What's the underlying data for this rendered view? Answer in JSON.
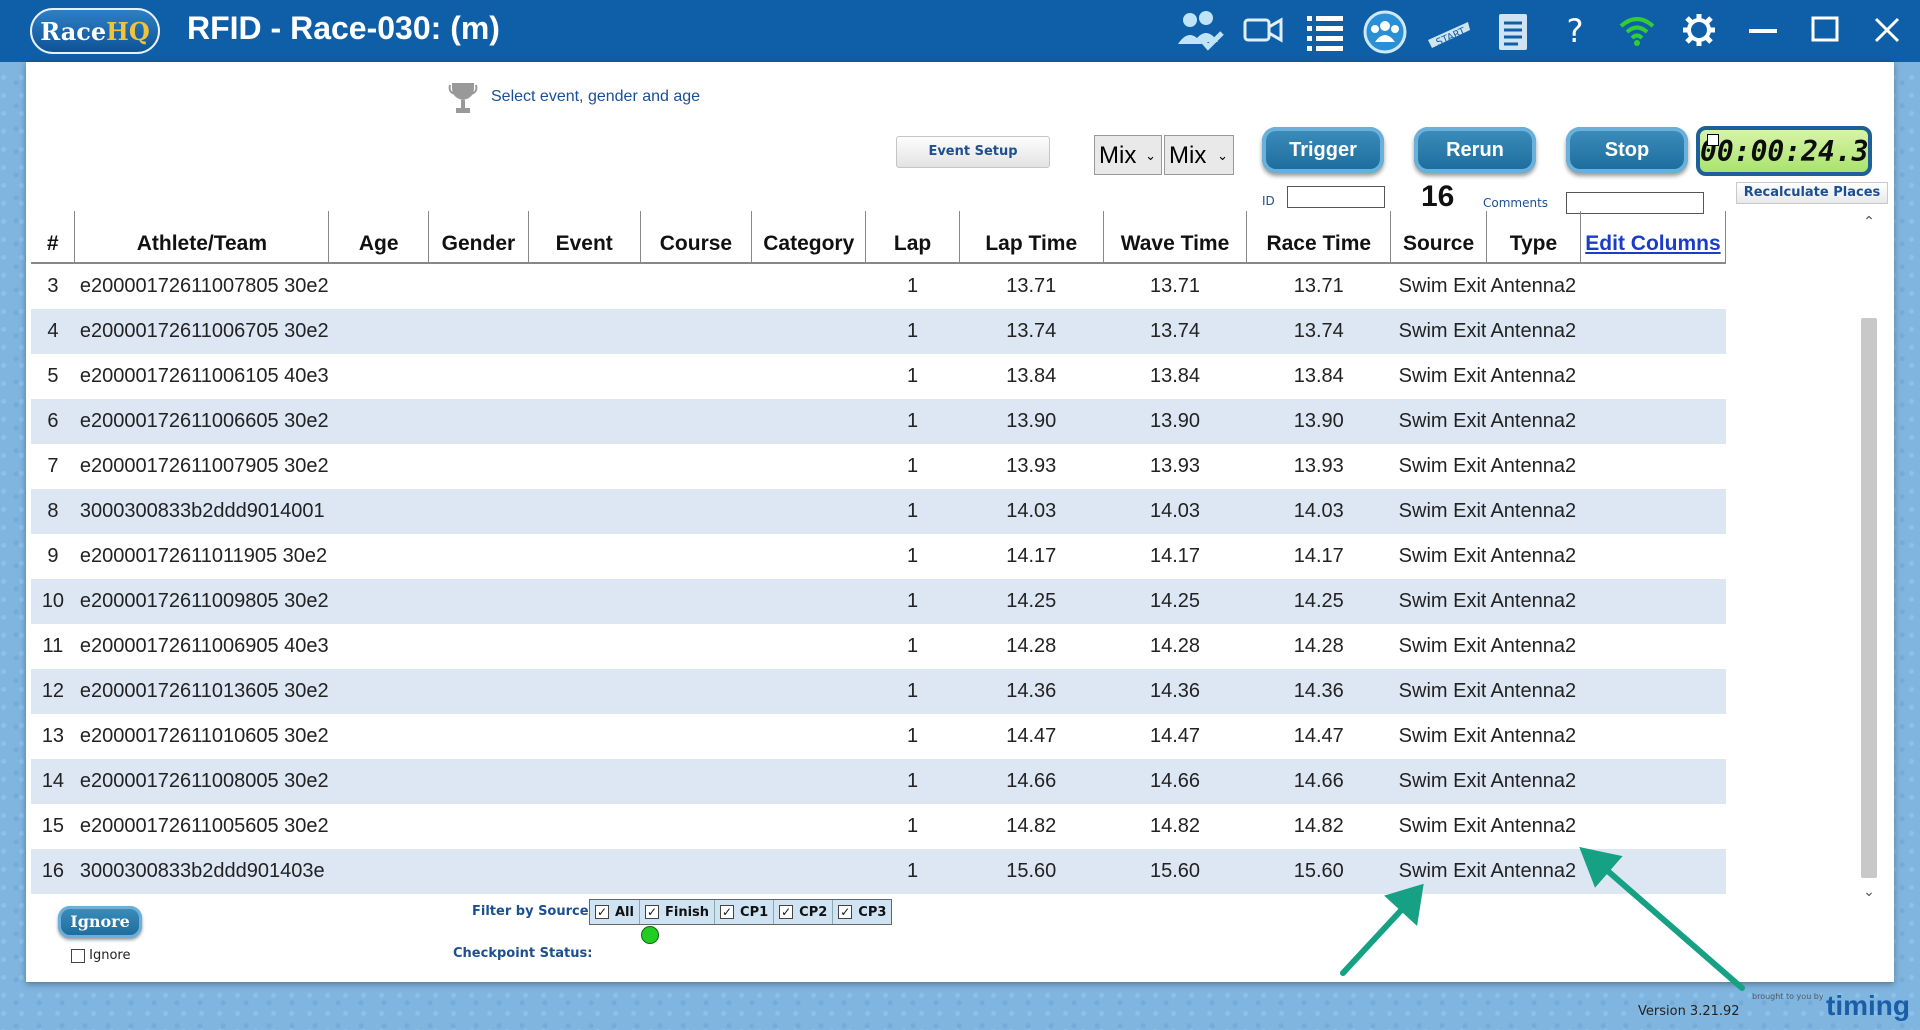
{
  "window": {
    "logo_race": "Race",
    "logo_hq": "HQ",
    "title": "RFID - Race-030: (m)"
  },
  "toolbar_icons": [
    "athletes-check-icon",
    "video-camera-icon",
    "list-icon",
    "group-icon",
    "start-icon",
    "document-icon",
    "help-icon",
    "wifi-icon",
    "settings-icon",
    "minimize-icon",
    "maximize-icon",
    "close-icon"
  ],
  "controls": {
    "event_select_label": "Select event, gender and age",
    "event_setup": "Event Setup",
    "gender_select": "Mix",
    "age_select": "Mix",
    "trigger": "Trigger",
    "rerun": "Rerun",
    "stop": "Stop",
    "timer": "00:00:24.3",
    "recalculate": "Recalculate Places",
    "id_label": "ID",
    "id_value": "",
    "count": "16",
    "comments_label": "Comments",
    "comments_value": ""
  },
  "table": {
    "columns": [
      "#",
      "Athlete/Team",
      "Age",
      "Gender",
      "Event",
      "Course",
      "Category",
      "Lap",
      "Lap Time",
      "Wave Time",
      "Race Time",
      "Source",
      "Type",
      "Edit Columns"
    ],
    "rows": [
      {
        "num": "3",
        "athlete": "e20000172611007805 30e2",
        "lap": "1",
        "lap_time": "13.71",
        "wave_time": "13.71",
        "race_time": "13.71",
        "source": "Swim Exit",
        "type": "Antenna2"
      },
      {
        "num": "4",
        "athlete": "e20000172611006705 30e2",
        "lap": "1",
        "lap_time": "13.74",
        "wave_time": "13.74",
        "race_time": "13.74",
        "source": "Swim Exit",
        "type": "Antenna2"
      },
      {
        "num": "5",
        "athlete": "e20000172611006105 40e3",
        "lap": "1",
        "lap_time": "13.84",
        "wave_time": "13.84",
        "race_time": "13.84",
        "source": "Swim Exit",
        "type": "Antenna2"
      },
      {
        "num": "6",
        "athlete": "e20000172611006605 30e2",
        "lap": "1",
        "lap_time": "13.90",
        "wave_time": "13.90",
        "race_time": "13.90",
        "source": "Swim Exit",
        "type": "Antenna2"
      },
      {
        "num": "7",
        "athlete": "e20000172611007905 30e2",
        "lap": "1",
        "lap_time": "13.93",
        "wave_time": "13.93",
        "race_time": "13.93",
        "source": "Swim Exit",
        "type": "Antenna2"
      },
      {
        "num": "8",
        "athlete": "3000300833b2ddd9014001",
        "lap": "1",
        "lap_time": "14.03",
        "wave_time": "14.03",
        "race_time": "14.03",
        "source": "Swim Exit",
        "type": "Antenna2"
      },
      {
        "num": "9",
        "athlete": "e20000172611011905 30e2",
        "lap": "1",
        "lap_time": "14.17",
        "wave_time": "14.17",
        "race_time": "14.17",
        "source": "Swim Exit",
        "type": "Antenna2"
      },
      {
        "num": "10",
        "athlete": "e20000172611009805 30e2",
        "lap": "1",
        "lap_time": "14.25",
        "wave_time": "14.25",
        "race_time": "14.25",
        "source": "Swim Exit",
        "type": "Antenna2"
      },
      {
        "num": "11",
        "athlete": "e20000172611006905 40e3",
        "lap": "1",
        "lap_time": "14.28",
        "wave_time": "14.28",
        "race_time": "14.28",
        "source": "Swim Exit",
        "type": "Antenna2"
      },
      {
        "num": "12",
        "athlete": "e20000172611013605 30e2",
        "lap": "1",
        "lap_time": "14.36",
        "wave_time": "14.36",
        "race_time": "14.36",
        "source": "Swim Exit",
        "type": "Antenna2"
      },
      {
        "num": "13",
        "athlete": "e20000172611010605 30e2",
        "lap": "1",
        "lap_time": "14.47",
        "wave_time": "14.47",
        "race_time": "14.47",
        "source": "Swim Exit",
        "type": "Antenna2"
      },
      {
        "num": "14",
        "athlete": "e20000172611008005 30e2",
        "lap": "1",
        "lap_time": "14.66",
        "wave_time": "14.66",
        "race_time": "14.66",
        "source": "Swim Exit",
        "type": "Antenna2"
      },
      {
        "num": "15",
        "athlete": "e20000172611005605 30e2",
        "lap": "1",
        "lap_time": "14.82",
        "wave_time": "14.82",
        "race_time": "14.82",
        "source": "Swim Exit",
        "type": "Antenna2"
      },
      {
        "num": "16",
        "athlete": "3000300833b2ddd901403е",
        "lap": "1",
        "lap_time": "15.60",
        "wave_time": "15.60",
        "race_time": "15.60",
        "source": "Swim Exit",
        "type": "Antenna2"
      }
    ]
  },
  "bottom": {
    "ignore_button": "Ignore",
    "ignore_checkbox": "Ignore",
    "filter_label": "Filter by Source:",
    "filters": [
      "All",
      "Finish",
      "CP1",
      "CP2",
      "CP3"
    ],
    "checkpoint_status_label": "Checkpoint Status:",
    "status_color": "#22cc22",
    "version": "Version 3.21.92",
    "brought_by": "brought to you by",
    "brand": "timing"
  },
  "colors": {
    "titlebar": "#0f5fa8",
    "accent_button": "#1b6a9c",
    "row_alt": "#dde7f3",
    "arrow": "#17a184"
  }
}
